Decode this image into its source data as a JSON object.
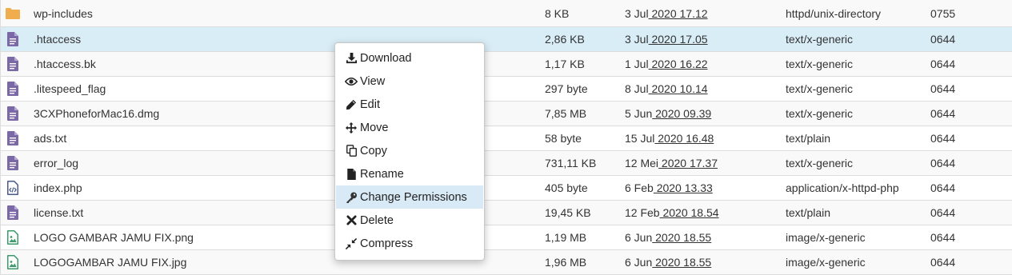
{
  "files": [
    {
      "name": "wp-includes",
      "size": "8 KB",
      "date_day": "3 Jul",
      "date_year_time": " 2020 17.12",
      "type": "httpd/unix-directory",
      "perms": "0755",
      "icon": "folder-icon",
      "selected": false
    },
    {
      "name": ".htaccess",
      "size": "2,86 KB",
      "date_day": "3 Jul",
      "date_year_time": " 2020 17.05",
      "type": "text/x-generic",
      "perms": "0644",
      "icon": "text-file-icon",
      "selected": true
    },
    {
      "name": ".htaccess.bk",
      "size": "1,17 KB",
      "date_day": "1 Jul",
      "date_year_time": " 2020 16.22",
      "type": "text/x-generic",
      "perms": "0644",
      "icon": "text-file-icon",
      "selected": false
    },
    {
      "name": ".litespeed_flag",
      "size": "297 byte",
      "date_day": "8 Jul",
      "date_year_time": " 2020 10.14",
      "type": "text/x-generic",
      "perms": "0644",
      "icon": "text-file-icon",
      "selected": false
    },
    {
      "name": "3CXPhoneforMac16.dmg",
      "size": "7,85 MB",
      "date_day": "5 Jun",
      "date_year_time": " 2020 09.39",
      "type": "text/x-generic",
      "perms": "0644",
      "icon": "text-file-icon",
      "selected": false
    },
    {
      "name": "ads.txt",
      "size": "58 byte",
      "date_day": "15 Jul",
      "date_year_time": " 2020 16.48",
      "type": "text/plain",
      "perms": "0644",
      "icon": "text-file-icon",
      "selected": false
    },
    {
      "name": "error_log",
      "size": "731,11 KB",
      "date_day": "12 Mei",
      "date_year_time": " 2020 17.37",
      "type": "text/x-generic",
      "perms": "0644",
      "icon": "text-file-icon",
      "selected": false
    },
    {
      "name": "index.php",
      "size": "405 byte",
      "date_day": "6 Feb",
      "date_year_time": " 2020 13.33",
      "type": "application/x-httpd-php",
      "perms": "0644",
      "icon": "code-file-icon",
      "selected": false
    },
    {
      "name": "license.txt",
      "size": "19,45 KB",
      "date_day": "12 Feb",
      "date_year_time": " 2020 18.54",
      "type": "text/plain",
      "perms": "0644",
      "icon": "text-file-icon",
      "selected": false
    },
    {
      "name": "LOGO GAMBAR JAMU FIX.png",
      "size": "1,19 MB",
      "date_day": "6 Jun",
      "date_year_time": " 2020 18.55",
      "type": "image/x-generic",
      "perms": "0644",
      "icon": "image-file-icon",
      "selected": false
    },
    {
      "name": "LOGOGAMBAR JAMU FIX.jpg",
      "size": "1,96 MB",
      "date_day": "6 Jun",
      "date_year_time": " 2020 18.55",
      "type": "image/x-generic",
      "perms": "0644",
      "icon": "image-file-icon",
      "selected": false
    }
  ],
  "context_menu": {
    "items": [
      {
        "label": "Download",
        "icon": "download-icon"
      },
      {
        "label": "View",
        "icon": "eye-icon"
      },
      {
        "label": "Edit",
        "icon": "pencil-icon"
      },
      {
        "label": "Move",
        "icon": "move-arrows-icon"
      },
      {
        "label": "Copy",
        "icon": "copy-icon"
      },
      {
        "label": "Rename",
        "icon": "file-icon"
      },
      {
        "label": "Change Permissions",
        "icon": "key-icon",
        "highlighted": true
      },
      {
        "label": "Delete",
        "icon": "times-icon"
      },
      {
        "label": "Compress",
        "icon": "compress-icon"
      }
    ]
  },
  "colors": {
    "folder": "#f0ad4e",
    "text_file": "#7b68a6",
    "code_file": "#4a5a8a",
    "image_file": "#3c9a6c",
    "selected_row": "#d9edf7",
    "menu_highlight": "#d9eaf7"
  }
}
